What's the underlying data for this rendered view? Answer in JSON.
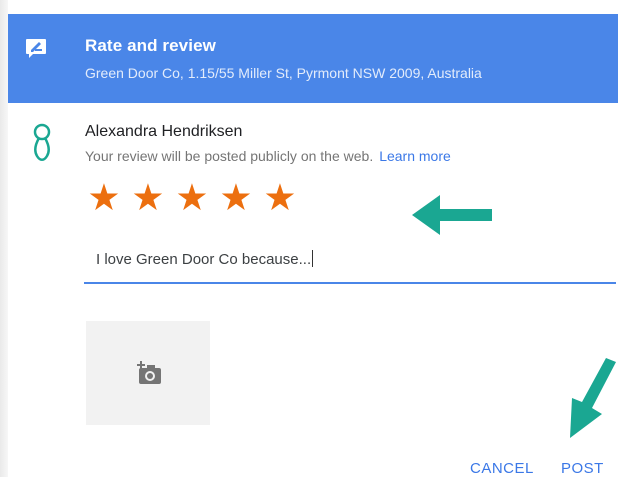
{
  "header": {
    "title": "Rate and review",
    "subtitle": "Green Door Co, 1.15/55 Miller St, Pyrmont NSW 2009, Australia",
    "icon": "rate-review-icon",
    "bg_color": "#4a86e8"
  },
  "user": {
    "name": "Alexandra Hendriksen",
    "icon": "avatar-icon",
    "notice": "Your review will be posted publicly on the web.",
    "learn_more": "Learn more"
  },
  "rating": {
    "value": 5,
    "max": 5,
    "stars": [
      "★",
      "★",
      "★",
      "★",
      "★"
    ],
    "color": "#ec6f0f"
  },
  "review": {
    "text": "I love Green Door Co because..."
  },
  "photo": {
    "icon": "add-photo-icon"
  },
  "actions": {
    "cancel": "CANCEL",
    "post": "POST"
  },
  "annotation": {
    "color": "#1aa792"
  }
}
